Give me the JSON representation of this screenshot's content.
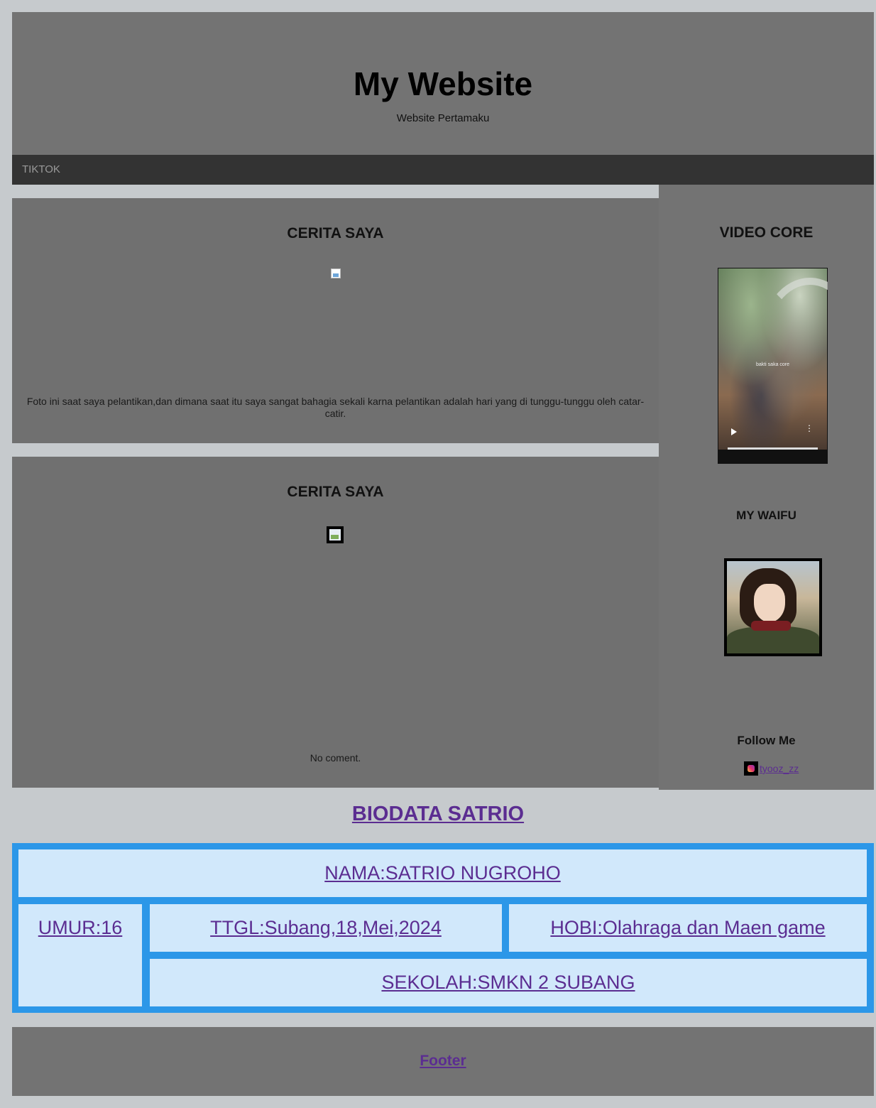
{
  "header": {
    "title": "My Website",
    "subtitle": "Website Pertamaku"
  },
  "nav": {
    "items": [
      {
        "label": "TIKTOK"
      }
    ]
  },
  "main": {
    "cards": [
      {
        "title": "CERITA SAYA",
        "caption": "Foto ini saat saya pelantikan,dan dimana saat itu saya sangat bahagia sekali karna pelantikan adalah hari yang di tunggu-tunggu oleh catar-catir."
      },
      {
        "title": "CERITA SAYA",
        "caption": "No coment."
      }
    ]
  },
  "sidebar": {
    "video_title": "VIDEO CORE",
    "video_overlay_text": "bakti saka core",
    "waifu_title": "MY WAIFU",
    "follow_title": "Follow Me",
    "instagram_handle": "tyooz_zz"
  },
  "biodata": {
    "title": "BIODATA SATRIO",
    "nama": "NAMA:SATRIO NUGROHO",
    "umur": "UMUR:16",
    "ttgl": "TTGL:Subang,18,Mei,2024",
    "hobi": "HOBI:Olahraga dan Maen game",
    "sekolah": "SEKOLAH:SMKN 2 SUBANG"
  },
  "footer": {
    "label": "Footer"
  },
  "colors": {
    "page_bg": "#c6cacd",
    "panel_bg": "#737373",
    "nav_bg": "#333333",
    "link": "#5b2d91",
    "table_border": "#2c97e8",
    "table_cell": "#d1e8fb"
  }
}
